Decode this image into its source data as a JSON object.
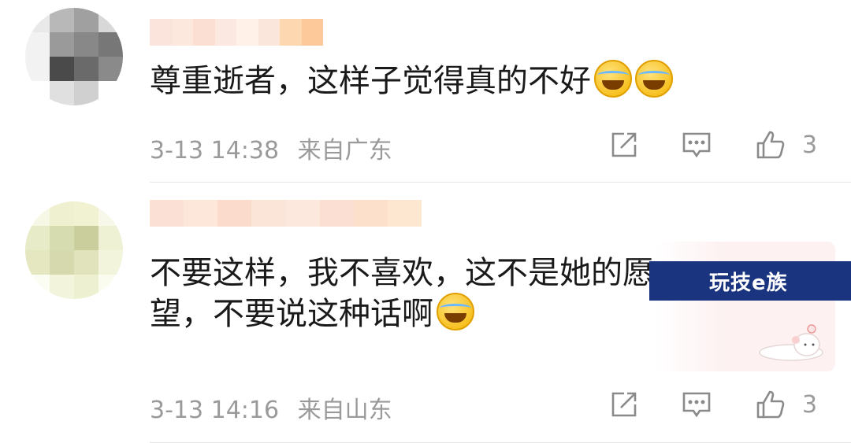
{
  "comments": [
    {
      "text": "尊重逝者，这样子觉得真的不好",
      "emojis": [
        "laugh-cry-emoji",
        "laugh-cry-emoji"
      ],
      "time": "3-13 14:38",
      "location": "来自广东",
      "likes": "3",
      "avatar_colors": [
        "#e9e9e9",
        "#b8b8b8",
        "#a0a0a0",
        "#d8d8d8",
        "#f2f2f2",
        "#9a9a9a",
        "#888888",
        "#777777",
        "#f2f2f2",
        "#4a4a4a",
        "#6a6a6a",
        "#8a8a8a",
        "#ffffff",
        "#e0e0e0",
        "#d0d0d0",
        "#ffffff"
      ],
      "username_colors": [
        "#fbe4dc",
        "#fde8de",
        "#fbdfd3",
        "#fbe8e0",
        "#fff0e8",
        "#fbe6dc",
        "#fdd7b0",
        "#fdc89a"
      ]
    },
    {
      "text": "不要这样，我不喜欢，这不是她的愿望，不要说这种话啊",
      "emojis": [
        "laugh-cry-emoji"
      ],
      "time": "3-13 14:16",
      "location": "来自山东",
      "likes": "3",
      "avatar_colors": [
        "#f6f7e4",
        "#eef0cf",
        "#f0f2d2",
        "#f7f8ea",
        "#e8ebc8",
        "#d7dbb0",
        "#c9ce9c",
        "#eef1d4",
        "#e4e7c0",
        "#d5d9ad",
        "#e0e3bb",
        "#f2f4dc",
        "#fbfcf2",
        "#f2f4dc",
        "#eef0d2",
        "#fbfcf0"
      ],
      "username_colors": [
        "#fbe0d6",
        "#fde6da",
        "#fbdccc",
        "#fbe4d8",
        "#fde8de",
        "#fbdfd3",
        "#fce0cc",
        "#fde7d0"
      ]
    }
  ],
  "watermark": "玩技e族",
  "colors": {
    "text": "#1a1a1a",
    "meta": "#9a9a9a",
    "divider": "#e6e6e6",
    "watermark_bg": "#1a3480"
  },
  "icons": [
    "share-icon",
    "reply-icon",
    "like-icon",
    "laugh-cry-emoji",
    "cat-sticker"
  ]
}
